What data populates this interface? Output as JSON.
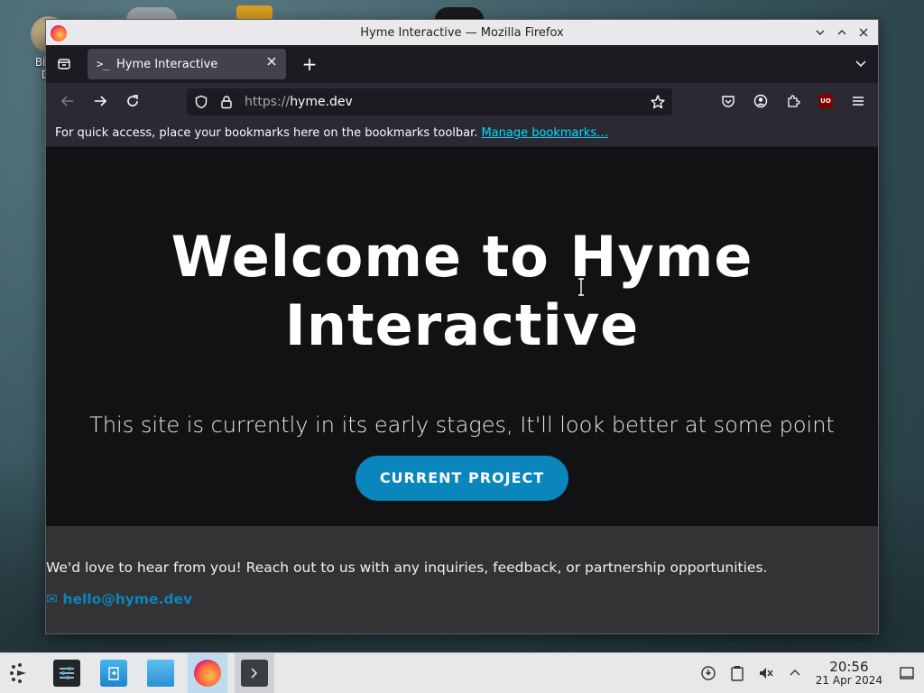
{
  "desktop": {
    "icon_label_line1": "Big T",
    "icon_label_line2": "De"
  },
  "window": {
    "title": "Hyme Interactive — Mozilla Firefox",
    "controls": [
      "minimize",
      "maximize",
      "close"
    ]
  },
  "tabs": {
    "active": {
      "favicon": ">_",
      "title": "Hyme Interactive"
    },
    "new_tab_label": "+"
  },
  "navbar": {
    "url_scheme": "https://",
    "url_host": "hyme.dev"
  },
  "bookmarks_bar": {
    "message": "For quick access, place your bookmarks here on the bookmarks toolbar.",
    "link": "Manage bookmarks…"
  },
  "page": {
    "hero_line1": "Welcome to Hyme",
    "hero_line2": "Interactive",
    "tagline": "This site is currently in its early stages, It'll look better at some point",
    "cta_label": "CURRENT PROJECT",
    "contact_message": "We'd love to hear from you! Reach out to us with any inquiries, feedback, or partnership opportunities.",
    "email_icon": "✉",
    "email": "hello@hyme.dev"
  },
  "taskbar": {
    "time": "20:56",
    "date": "21 Apr 2024",
    "apps": [
      "application-launcher",
      "system-settings",
      "discover-store",
      "file-manager",
      "firefox",
      "konsole"
    ]
  },
  "colors": {
    "accent": "#0a86bd",
    "link": "#00ddff",
    "hero_bg": "#121113",
    "contact_bg": "#333235"
  }
}
